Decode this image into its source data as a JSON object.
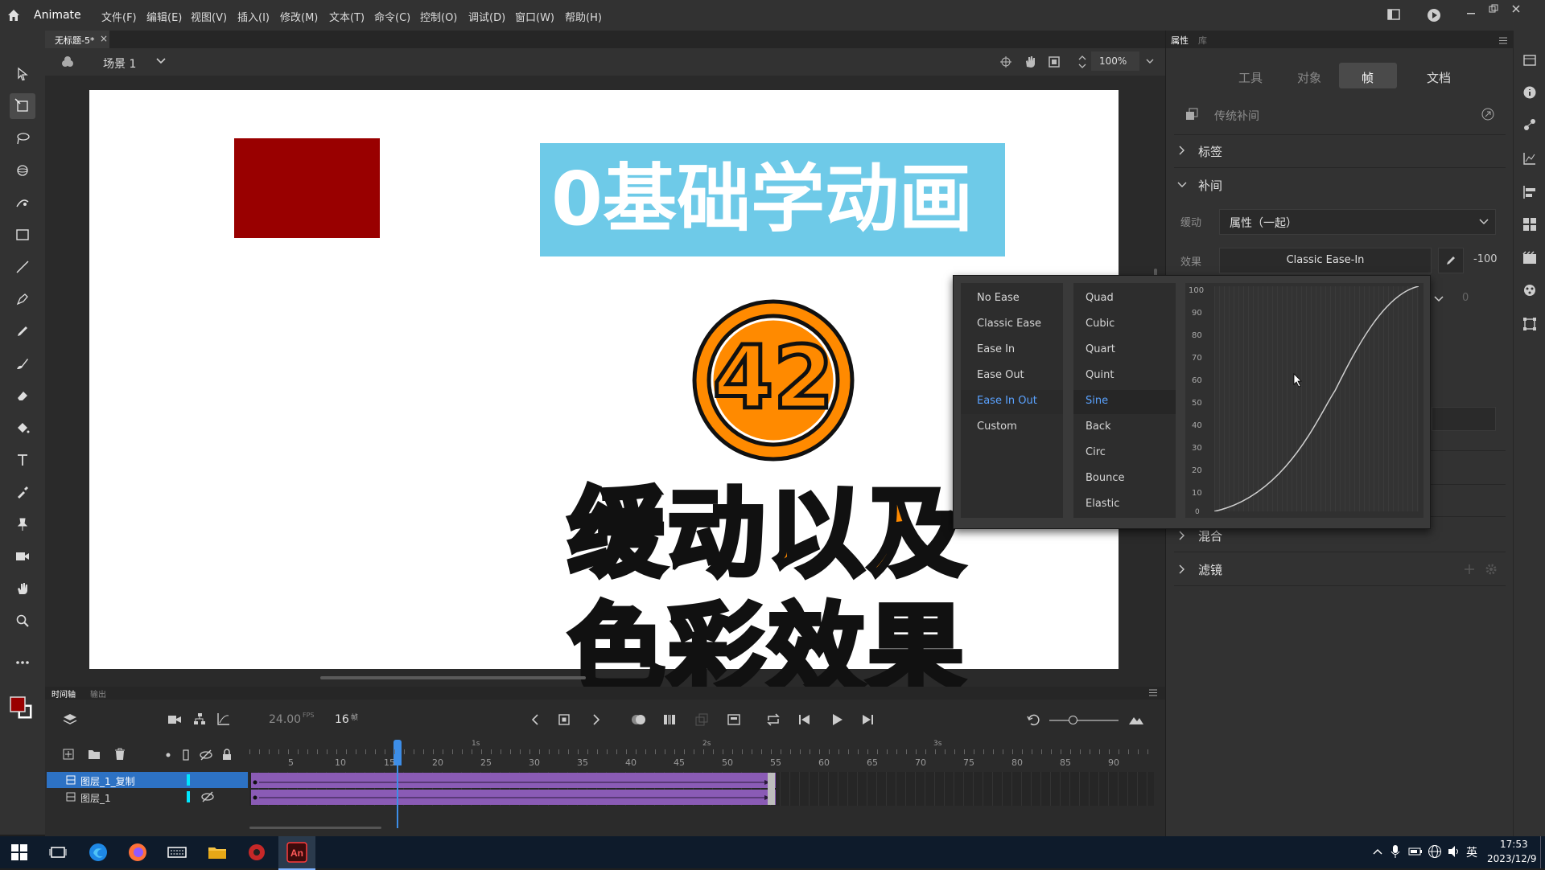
{
  "app": {
    "name": "Animate"
  },
  "menu": [
    "文件(F)",
    "编辑(E)",
    "视图(V)",
    "插入(I)",
    "修改(M)",
    "文本(T)",
    "命令(C)",
    "控制(O)",
    "调试(D)",
    "窗口(W)",
    "帮助(H)"
  ],
  "doc": {
    "tab": "无标题-5*",
    "tab_close": "×",
    "scene": "场景 1",
    "zoom": "100%"
  },
  "stage": {
    "title": "0基础学动画",
    "number": "42",
    "line1": "缓动以及",
    "line2": "色彩效果"
  },
  "timeline": {
    "tabs": [
      "时间轴",
      "输出"
    ],
    "fps": "24.00",
    "fps_unit": "FPS",
    "frame": "16",
    "frame_unit": "帧",
    "seconds": [
      "1s",
      "2s",
      "3s"
    ],
    "frame_numbers": [
      "5",
      "10",
      "15",
      "20",
      "25",
      "30",
      "35",
      "40",
      "45",
      "50",
      "55",
      "60",
      "65",
      "70",
      "75",
      "80",
      "85",
      "90"
    ],
    "layers": [
      {
        "name": "图层_1_复制"
      },
      {
        "name": "图层_1"
      }
    ]
  },
  "props": {
    "panel_tabs": [
      "属性",
      "库"
    ],
    "tabs": [
      "工具",
      "对象",
      "帧",
      "文档"
    ],
    "active_tab": "帧",
    "tween_type": "传统补间",
    "sections": {
      "label": "标签",
      "tween": "补间",
      "blend": "混合",
      "filter": "滤镜"
    },
    "ease_label": "缓动",
    "ease_value": "属性（一起）",
    "effect_label": "效果",
    "effect_value": "Classic Ease-In",
    "effect_amount": "-100",
    "extra_value": "0"
  },
  "ease_popup": {
    "categories": [
      "No Ease",
      "Classic Ease",
      "Ease In",
      "Ease Out",
      "Ease In Out",
      "Custom"
    ],
    "selected_category": "Ease In Out",
    "types": [
      "Quad",
      "Cubic",
      "Quart",
      "Quint",
      "Sine",
      "Back",
      "Circ",
      "Bounce",
      "Elastic"
    ],
    "selected_type": "Sine",
    "y_ticks": [
      "100",
      "90",
      "80",
      "70",
      "60",
      "50",
      "40",
      "30",
      "20",
      "10",
      "0"
    ]
  },
  "taskbar": {
    "ime": "英",
    "time": "17:53",
    "date": "2023/12/9"
  },
  "colors": {
    "accent": "#1473e6",
    "stage_rect": "#990000",
    "title_bg": "#6ecae8",
    "badge": "#ff8a00",
    "layer_span": "#8a5bb5",
    "playhead": "#3d8ee8"
  }
}
